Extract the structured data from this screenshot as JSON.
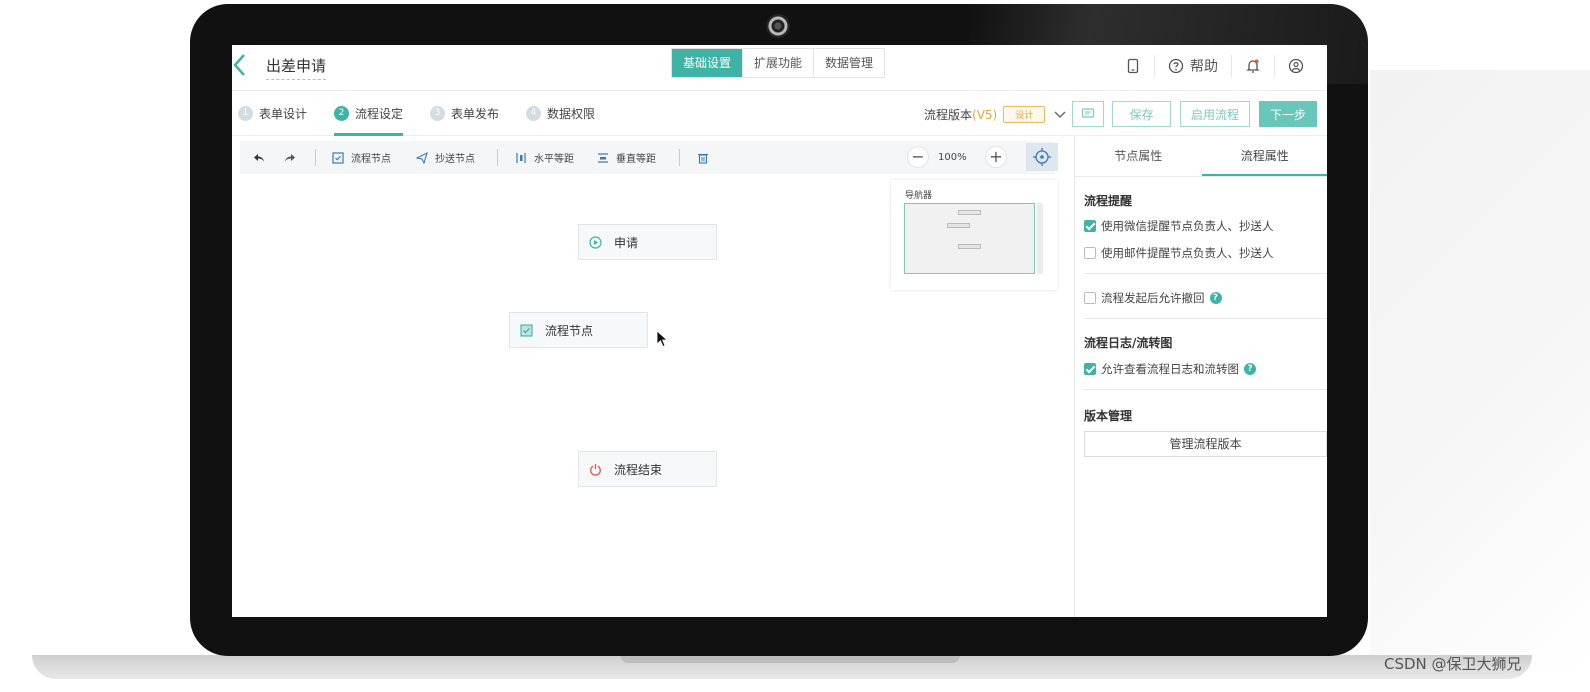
{
  "header": {
    "back_icon": "chevron-left-icon",
    "title": "出差申请",
    "tabs": [
      {
        "label": "基础设置",
        "active": true
      },
      {
        "label": "扩展功能",
        "active": false
      },
      {
        "label": "数据管理",
        "active": false
      }
    ],
    "help_label": "帮助",
    "icons": [
      "tablet-icon",
      "question-circle-icon",
      "bell-icon",
      "user-circle-icon"
    ]
  },
  "steps": [
    {
      "num": "1",
      "label": "表单设计",
      "active": false
    },
    {
      "num": "2",
      "label": "流程设定",
      "active": true
    },
    {
      "num": "3",
      "label": "表单发布",
      "active": false
    },
    {
      "num": "4",
      "label": "数据权限",
      "active": false
    }
  ],
  "version": {
    "label": "流程版本",
    "value": "(V5)",
    "badge": "设计"
  },
  "actions": {
    "save": "保存",
    "enable": "启用流程",
    "next": "下一步"
  },
  "toolbar": {
    "flow_node": "流程节点",
    "cc_node": "抄送节点",
    "h_spacing": "水平等距",
    "v_spacing": "垂直等距",
    "zoom": "100%"
  },
  "canvas": {
    "nodes": {
      "apply": "申请",
      "flow": "流程节点",
      "end": "流程结束"
    },
    "navigator_title": "导航器"
  },
  "panel": {
    "tabs": [
      {
        "label": "节点属性",
        "active": false
      },
      {
        "label": "流程属性",
        "active": true
      }
    ],
    "reminder_title": "流程提醒",
    "wechat_reminder": "使用微信提醒节点负责人、抄送人",
    "email_reminder": "使用邮件提醒节点负责人、抄送人",
    "allow_withdraw": "流程发起后允许撤回",
    "log_title": "流程日志/流转图",
    "allow_view_log": "允许查看流程日志和流转图",
    "version_title": "版本管理",
    "manage_version": "管理流程版本"
  },
  "colors": {
    "accent": "#3fb4a6",
    "badge": "#f0a53a"
  },
  "watermark": "CSDN @保卫大狮兄"
}
